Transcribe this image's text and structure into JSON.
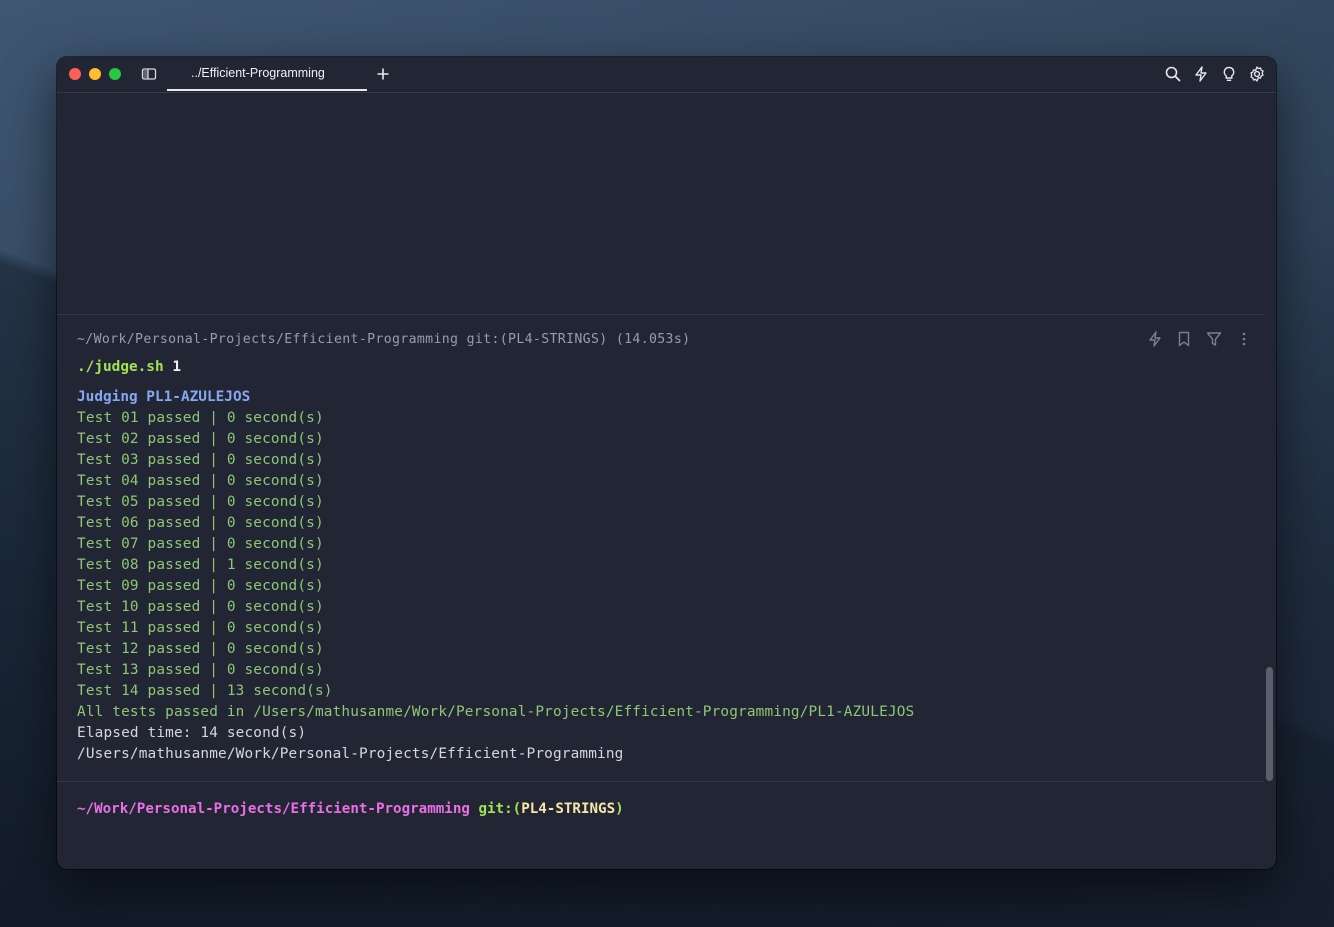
{
  "window": {
    "tab_title": "../Efficient-Programming",
    "toolbar_icons": [
      "search-icon",
      "bolt-icon",
      "lightbulb-icon",
      "gear-icon"
    ]
  },
  "block": {
    "header": "~/Work/Personal-Projects/Efficient-Programming git:(PL4-STRINGS) (14.053s)",
    "command": {
      "name": "./judge.sh",
      "arg": "1"
    },
    "judging": "Judging PL1-AZULEJOS",
    "tests": [
      "Test 01 passed | 0 second(s)",
      "Test 02 passed | 0 second(s)",
      "Test 03 passed | 0 second(s)",
      "Test 04 passed | 0 second(s)",
      "Test 05 passed | 0 second(s)",
      "Test 06 passed | 0 second(s)",
      "Test 07 passed | 0 second(s)",
      "Test 08 passed | 1 second(s)",
      "Test 09 passed | 0 second(s)",
      "Test 10 passed | 0 second(s)",
      "Test 11 passed | 0 second(s)",
      "Test 12 passed | 0 second(s)",
      "Test 13 passed | 0 second(s)",
      "Test 14 passed | 13 second(s)"
    ],
    "all_passed": "All tests passed in /Users/mathusanme/Work/Personal-Projects/Efficient-Programming/PL1-AZULEJOS",
    "elapsed": "Elapsed time: 14 second(s)",
    "cwd": "/Users/mathusanme/Work/Personal-Projects/Efficient-Programming",
    "action_icons": [
      "bolt-icon",
      "bookmark-icon",
      "filter-icon",
      "more-vertical-icon"
    ]
  },
  "prompt": {
    "path": "~/Work/Personal-Projects/Efficient-Programming",
    "git": "git:(",
    "branch": "PL4-STRINGS",
    "close": ")"
  },
  "colors": {
    "window_bg": "#222534",
    "command": "#a3e253",
    "judging": "#86a7f0",
    "passed": "#8ec774",
    "prompt_path": "#ea6fe6",
    "branch": "#f5e7a6"
  }
}
